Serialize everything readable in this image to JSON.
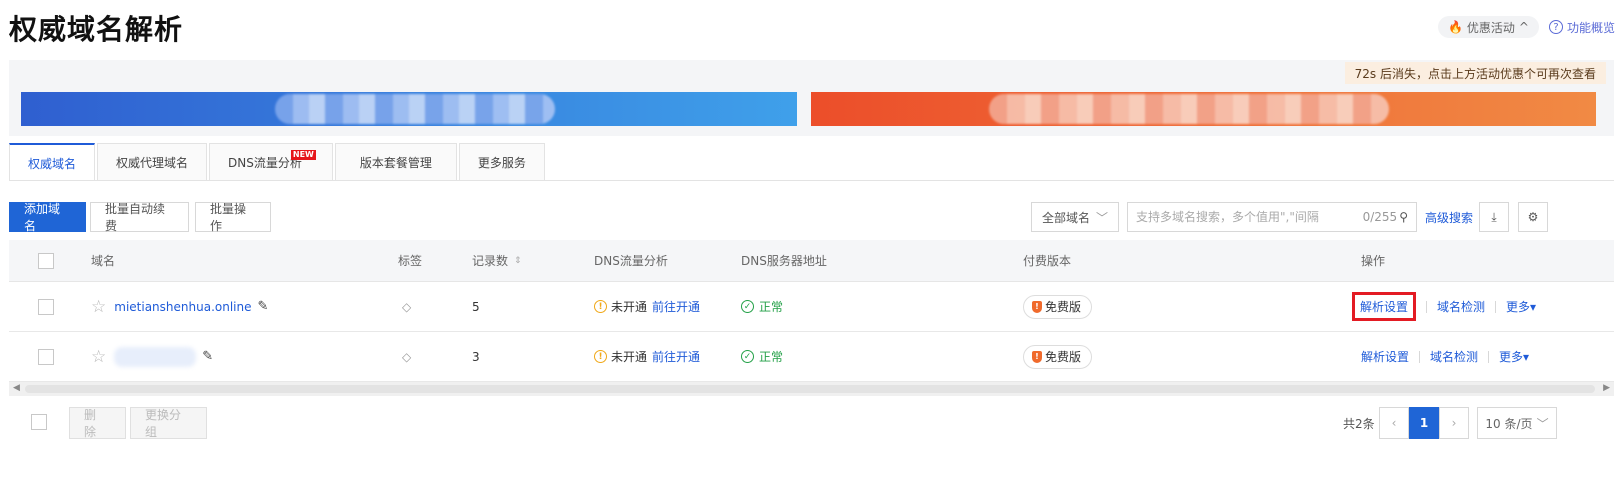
{
  "page": {
    "title": "权威域名解析",
    "promo_label": "优惠活动",
    "help_label": "功能概览",
    "banner_note": "72s 后消失，点击上方活动优惠个可再次查看"
  },
  "tabs": [
    {
      "label": "权威域名",
      "active": true
    },
    {
      "label": "权威代理域名"
    },
    {
      "label": "DNS流量分析",
      "badge": "NEW"
    },
    {
      "label": "版本套餐管理"
    },
    {
      "label": "更多服务"
    }
  ],
  "toolbar": {
    "add_label": "添加域名",
    "batch_renew_label": "批量自动续费",
    "batch_op_label": "批量操作",
    "filter_value": "全部域名",
    "search_placeholder": "支持多域名搜索，多个值用\",\"间隔",
    "search_counter": "0/255",
    "advanced_search_label": "高级搜索"
  },
  "table": {
    "columns": [
      "域名",
      "标签",
      "记录数",
      "DNS流量分析",
      "DNS服务器地址",
      "付费版本",
      "操作"
    ],
    "rows": [
      {
        "domain": "mietianshenhua.online",
        "records": "5",
        "dns_analysis_status": "未开通",
        "dns_analysis_link": "前往开通",
        "server_status": "正常",
        "plan": "免费版",
        "op_primary": "解析设置",
        "op_secondary": "域名检测",
        "op_more": "更多"
      },
      {
        "domain": "",
        "records": "3",
        "dns_analysis_status": "未开通",
        "dns_analysis_link": "前往开通",
        "server_status": "正常",
        "plan": "免费版",
        "op_primary": "解析设置",
        "op_secondary": "域名检测",
        "op_more": "更多"
      }
    ]
  },
  "footer": {
    "delete_label": "删 除",
    "change_group_label": "更换分组",
    "total": "共2条",
    "current_page": "1",
    "page_size": "10 条/页"
  },
  "colors": {
    "primary": "#1f65d6",
    "highlight": "#e31b23",
    "success": "#24a148",
    "warning": "#f0a818"
  }
}
